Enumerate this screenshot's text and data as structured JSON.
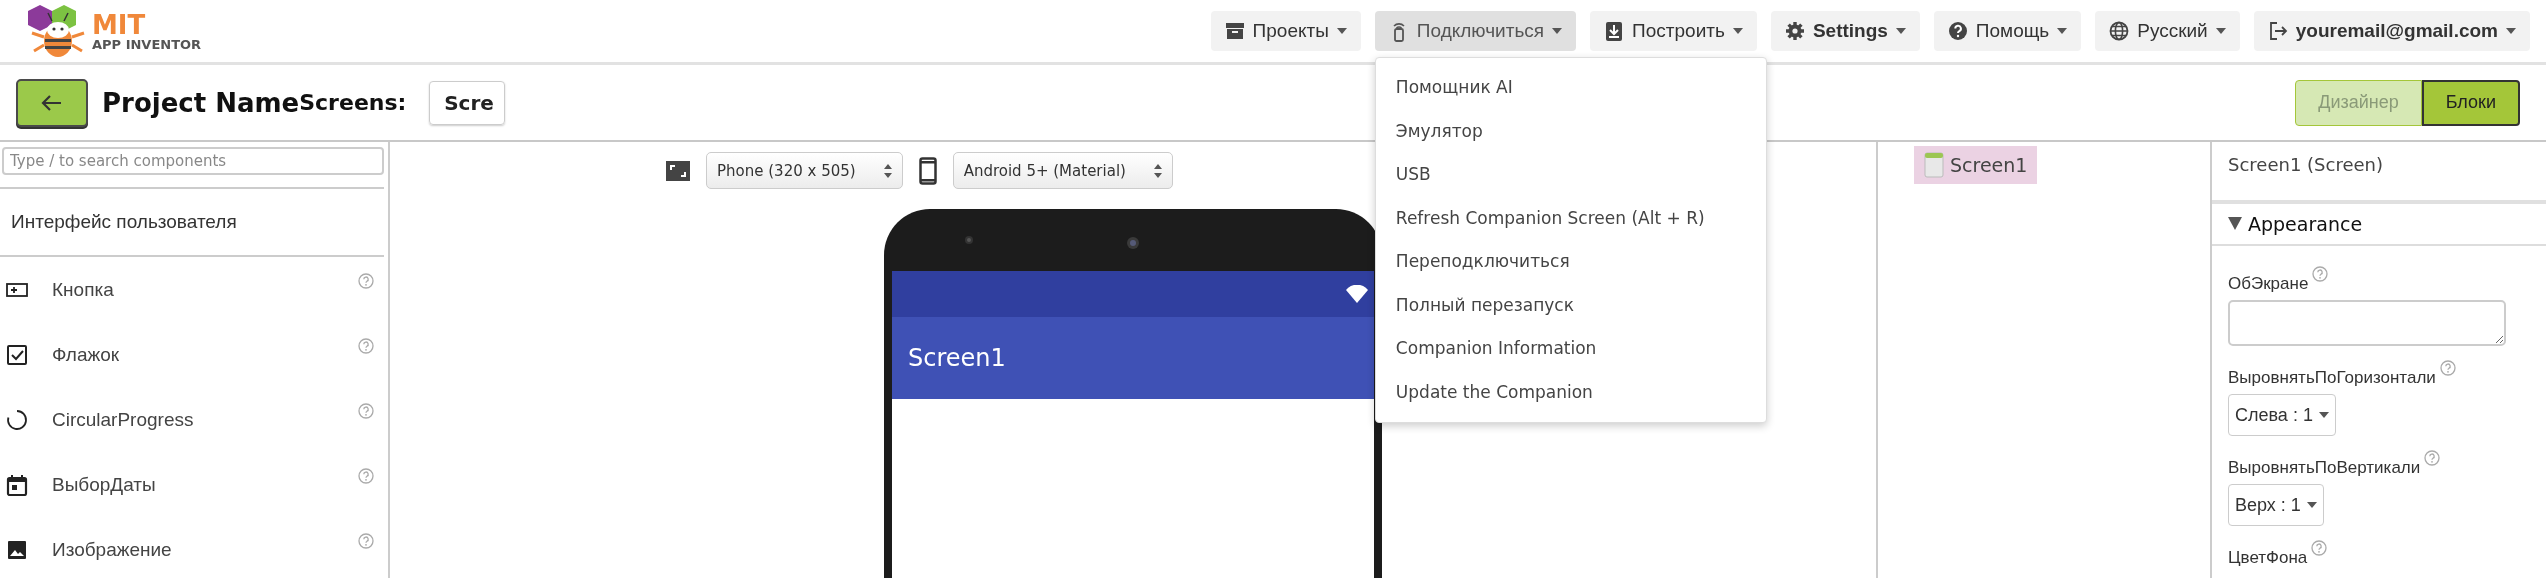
{
  "logo": {
    "title": "MIT",
    "subtitle": "APP INVENTOR"
  },
  "nav": [
    {
      "kind": "projects",
      "label": "Проекты",
      "expanded": false
    },
    {
      "kind": "connect",
      "label": "Подключиться",
      "expanded": true,
      "menu": [
        "Помощник AI",
        "Эмулятор",
        "USB",
        "Refresh Companion Screen (Alt + R)",
        "Переподключиться",
        "Полный перезапуск",
        "Companion Information",
        "Update the Companion"
      ]
    },
    {
      "kind": "build",
      "label": "Построить",
      "expanded": false
    },
    {
      "kind": "settings",
      "label": "Settings",
      "expanded": false
    },
    {
      "kind": "help",
      "label": "Помощь",
      "expanded": false
    },
    {
      "kind": "language",
      "label": "Русский",
      "expanded": false
    },
    {
      "kind": "account",
      "label": "youremail@gmail.com",
      "expanded": false
    }
  ],
  "project": {
    "name": "Project Name",
    "screens_label": "Screens:",
    "screen_value": "Scre"
  },
  "modes": [
    {
      "label": "Дизайнер",
      "selected": false
    },
    {
      "label": "Блоки",
      "selected": true
    }
  ],
  "palette": {
    "search_placeholder": "Type / to search components",
    "category": "Интерфейс пользователя",
    "items": [
      {
        "kind": "button",
        "label": "Кнопка"
      },
      {
        "kind": "checkbox",
        "label": "Флажок"
      },
      {
        "kind": "progress",
        "label": "CircularProgress"
      },
      {
        "kind": "datepicker",
        "label": "ВыборДаты"
      },
      {
        "kind": "image",
        "label": "Изображение"
      }
    ]
  },
  "viewer": {
    "size": "Phone (320 x 505)",
    "theme": "Android 5+ (Material)",
    "screen_title": "Screen1"
  },
  "tree": [
    {
      "label": "Screen1",
      "selected": true
    }
  ],
  "properties": {
    "title": "Screen1 (Screen)",
    "section": {
      "label": "Appearance",
      "expanded": true
    },
    "items": [
      {
        "kind": "textarea",
        "label": "ОбЭкране"
      },
      {
        "kind": "select",
        "label": "ВыровнятьПоГоризонтали",
        "value": "Слева : 1"
      },
      {
        "kind": "select",
        "label": "ВыровнятьПоВертикали",
        "value": "Верх : 1"
      },
      {
        "kind": "label",
        "label": "ЦветФона"
      }
    ]
  }
}
